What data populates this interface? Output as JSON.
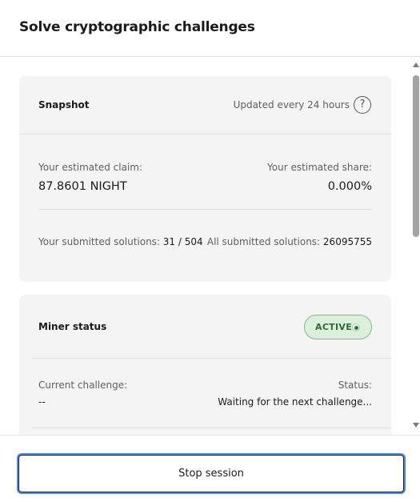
{
  "header": {
    "title": "Solve cryptographic challenges"
  },
  "snapshot": {
    "title": "Snapshot",
    "update_note": "Updated every 24 hours",
    "help_glyph": "?",
    "claim_label": "Your estimated claim:",
    "claim_value": "87.8601 NIGHT",
    "share_label": "Your estimated share:",
    "share_value": "0.000%",
    "submitted_label": "Your submitted solutions:",
    "submitted_value": "31 / 504",
    "all_label": "All submitted solutions:",
    "all_value": "26095755"
  },
  "miner": {
    "title": "Miner status",
    "badge": "ACTIVE",
    "badge_color": "#1f7a2b",
    "challenge_label": "Current challenge:",
    "challenge_value": "--",
    "status_label": "Status:",
    "status_value": "Waiting for the next challenge..."
  },
  "footer": {
    "stop_label": "Stop session"
  }
}
